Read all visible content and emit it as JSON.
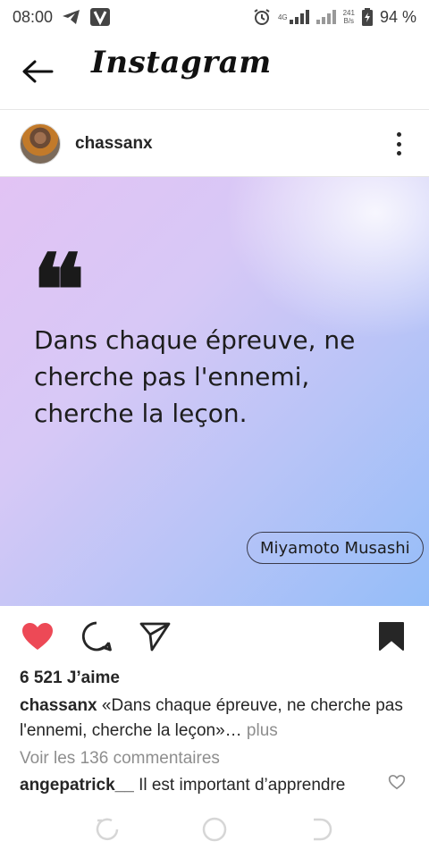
{
  "status_bar": {
    "time": "08:00",
    "network_label": "4G",
    "speed_value": "241",
    "speed_unit": "B/s",
    "battery": "94 %"
  },
  "header": {
    "logo": "Instagram"
  },
  "post": {
    "username": "chassanx",
    "quote": "Dans chaque épreuve, ne cherche pas l'ennemi, cherche la leçon.",
    "author": "Miyamoto Musashi",
    "likes": "6 521 J’aime",
    "caption_user": "chassanx",
    "caption_text": "«Dans chaque épreuve, ne cherche pas l'ennemi, cherche la leçon»…",
    "caption_more": " plus",
    "view_comments": "Voir les 136 commentaires",
    "comment_user": "angepatrick__",
    "comment_text": "Il est important d’apprendre"
  },
  "colors": {
    "heart": "#ed4956",
    "text": "#262626",
    "muted": "#8e8e8e"
  },
  "icons": [
    "back-arrow-icon",
    "more-options-icon",
    "heart-icon",
    "comment-icon",
    "share-icon",
    "bookmark-icon",
    "small-heart-icon"
  ]
}
